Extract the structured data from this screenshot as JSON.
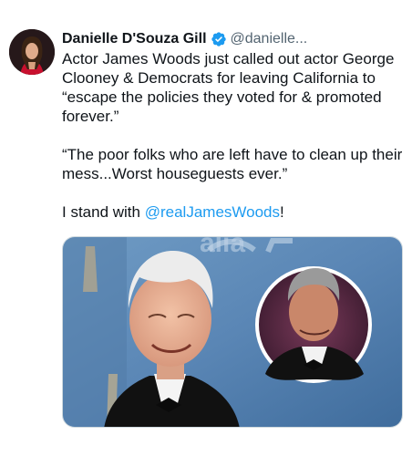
{
  "author": {
    "display_name": "Danielle D'Souza Gill",
    "handle": "@danielle...",
    "verified": true,
    "avatar_icon": "profile-photo"
  },
  "post": {
    "text_parts": [
      "Actor James Woods just called out actor George Clooney & Democrats for leaving California to “escape the policies they voted for & promoted forever.”",
      "“The poor folks who are left have to clean up their mess...Worst houseguests ever.”"
    ],
    "final_prefix": "I stand with ",
    "mention": "@realJamesWoods",
    "final_suffix": "!"
  },
  "media": {
    "backdrop_text": "alia",
    "image_icon": "photo-of-two-actors"
  },
  "colors": {
    "link": "#1d9bf0",
    "verified": "#1d9bf0",
    "muted": "#536471",
    "text": "#0f1419"
  }
}
